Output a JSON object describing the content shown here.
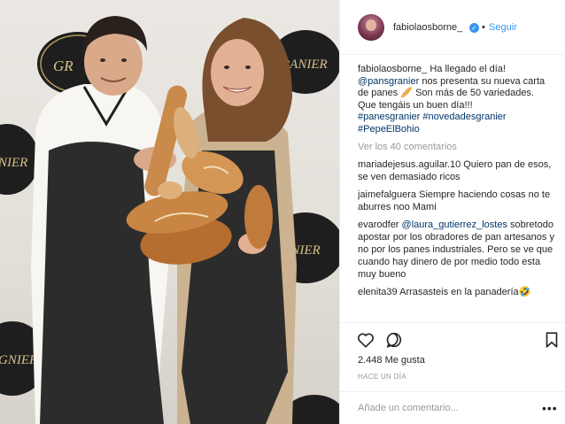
{
  "photo": {
    "brand_text": "GRANIER",
    "brand_text_left": "GR",
    "brand_text_lower": "RANIER",
    "brand_text_edge": "NIER",
    "brand_text_bottom": "GNIER"
  },
  "header": {
    "username": "fabiolaosborne_",
    "verified_icon": "verified-check-icon",
    "separator": "•",
    "follow_label": "Seguir"
  },
  "caption": {
    "username": "fabiolaosborne_",
    "text_1": " Ha llegado el día!",
    "mention": "@pansgranier",
    "text_2": " nos presenta su nueva carta de panes 🥖 Son más de 50 variedades. Que tengáis un buen día!!!",
    "hashtags": "#panesgranier #novedadesgranier #PepeElBohio"
  },
  "view_all": "Ver los 40 comentarios",
  "comments": [
    {
      "user": "mariadejesus.aguilar.10",
      "text": " Quiero pan de esos, se ven demasiado ricos"
    },
    {
      "user": "jaimefalguera",
      "text": " Siempre haciendo cosas no te aburres noo Mami"
    },
    {
      "user": "evarodfer",
      "mention": "@laura_gutierrez_lostes",
      "text": " sobretodo apostar por los obradores de pan artesanos y no por los panes industriales. Pero se ve que cuando hay dinero de por medio todo esta muy bueno"
    },
    {
      "user": "elenita39",
      "text": " Arrasasteis en la panadería🤣"
    }
  ],
  "actions": {
    "like_icon": "heart-icon",
    "comment_icon": "comment-bubble-icon",
    "save_icon": "bookmark-icon"
  },
  "likes": "2.448 Me gusta",
  "timestamp": "HACE UN DÍA",
  "add_comment": {
    "placeholder": "Añade un comentario...",
    "more_label": "•••"
  }
}
